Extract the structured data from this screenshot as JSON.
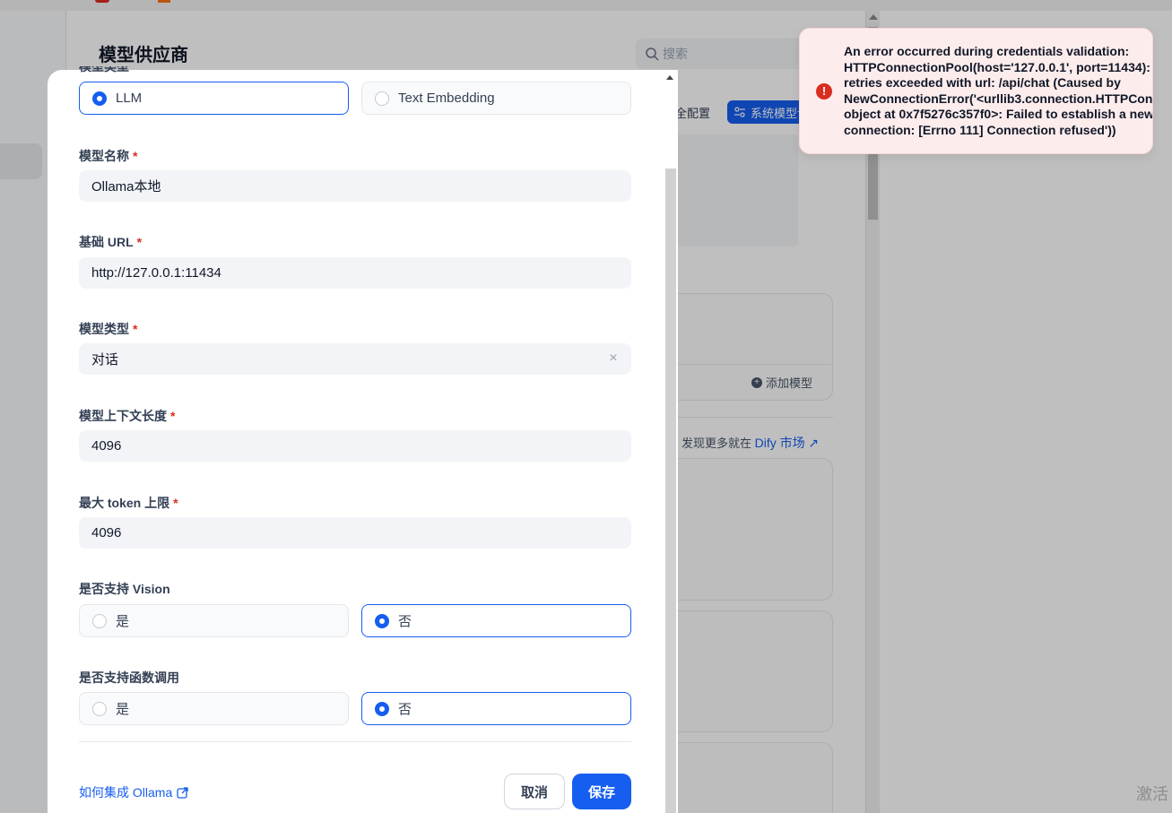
{
  "background": {
    "page_title": "模型供应商",
    "search_placeholder": "搜索",
    "security_button": "安全配置",
    "system_model_button": "系统模型设置",
    "add_model": "添加模型",
    "discover_prefix": "发现更多就在",
    "market_link": "Dify 市场",
    "watermark": "激活"
  },
  "modal": {
    "clipped_label": "模型类型",
    "model_type_radios": [
      {
        "label": "LLM",
        "selected": true
      },
      {
        "label": "Text Embedding",
        "selected": false
      }
    ],
    "fields": [
      {
        "label": "模型名称",
        "value": "Ollama本地"
      },
      {
        "label": "基础 URL",
        "value": "http://127.0.0.1:11434"
      },
      {
        "label": "模型类型",
        "value": "对话"
      },
      {
        "label": "模型上下文长度",
        "value": "4096"
      },
      {
        "label": "最大 token 上限",
        "value": "4096"
      }
    ],
    "required_mark": "*",
    "vision": {
      "label": "是否支持 Vision",
      "yes": "是",
      "no": "否",
      "selected": "no"
    },
    "function_call": {
      "label": "是否支持函数调用",
      "yes": "是",
      "no": "否",
      "selected": "no"
    },
    "help_link": "如何集成 Ollama",
    "cancel": "取消",
    "save": "保存"
  },
  "toast": {
    "message": "An error occurred during credentials validation:\nHTTPConnectionPool(host='127.0.0.1', port=11434): Max\nretries exceeded with url: /api/chat (Caused by\nNewConnectionError('<urllib3.connection.HTTPConnection\nobject at 0x7f5276c357f0>: Failed to establish a new\nconnection: [Errno 111] Connection refused'))"
  },
  "colors": {
    "primary": "#155eef",
    "error": "#d92d20",
    "toast_bg": "#fdecec"
  }
}
